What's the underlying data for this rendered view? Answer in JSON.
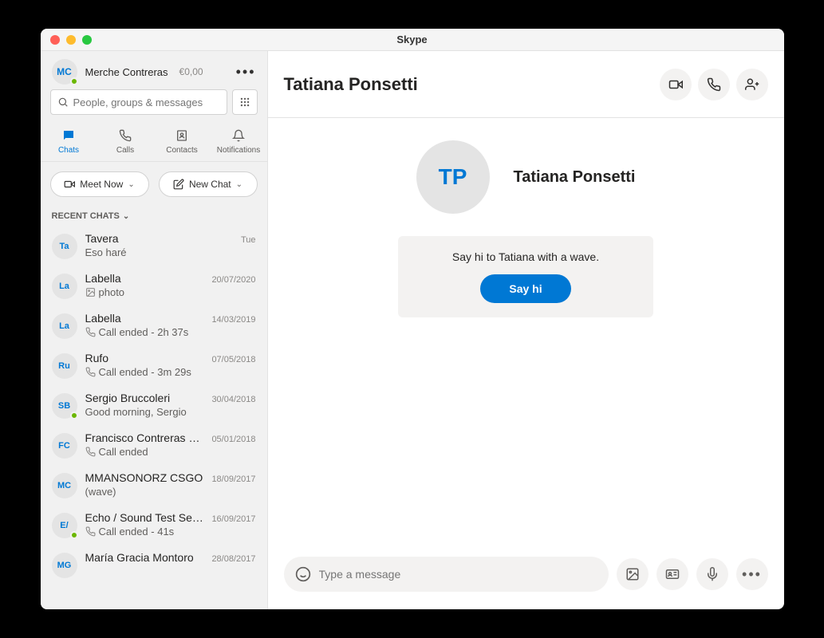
{
  "titlebar": {
    "title": "Skype"
  },
  "profile": {
    "initials": "MC",
    "name": "Merche Contreras",
    "balance": "€0,00"
  },
  "search": {
    "placeholder": "People, groups & messages"
  },
  "tabs": {
    "chats": "Chats",
    "calls": "Calls",
    "contacts": "Contacts",
    "notifications": "Notifications"
  },
  "actions": {
    "meet_now": "Meet Now",
    "new_chat": "New Chat"
  },
  "section": {
    "recent": "RECENT CHATS"
  },
  "chats": [
    {
      "initials": "Ta",
      "name": "Tavera",
      "date": "Tue",
      "preview": "Eso haré",
      "icon": "none",
      "presence": false
    },
    {
      "initials": "La",
      "name": "Labella",
      "date": "20/07/2020",
      "preview": "photo",
      "icon": "image",
      "presence": false
    },
    {
      "initials": "La",
      "name": "Labella",
      "date": "14/03/2019",
      "preview": "Call ended - 2h 37s",
      "icon": "call",
      "presence": false
    },
    {
      "initials": "Ru",
      "name": "Rufo",
      "date": "07/05/2018",
      "preview": "Call ended - 3m 29s",
      "icon": "call",
      "presence": false
    },
    {
      "initials": "SB",
      "name": "Sergio Bruccoleri",
      "date": "30/04/2018",
      "preview": "Good morning, Sergio",
      "icon": "none",
      "presence": true
    },
    {
      "initials": "FC",
      "name": "Francisco Contreras Segura",
      "date": "05/01/2018",
      "preview": "Call ended",
      "icon": "call",
      "presence": false
    },
    {
      "initials": "MC",
      "name": "MMANSONORZ CSGO",
      "date": "18/09/2017",
      "preview": "(wave)",
      "icon": "none",
      "presence": false
    },
    {
      "initials": "E/",
      "name": "Echo / Sound Test Service",
      "date": "16/09/2017",
      "preview": "Call ended - 41s",
      "icon": "call",
      "presence": true
    },
    {
      "initials": "MG",
      "name": "María Gracia Montoro",
      "date": "28/08/2017",
      "preview": "",
      "icon": "none",
      "presence": false
    }
  ],
  "conversation": {
    "title": "Tatiana Ponsetti",
    "initials": "TP",
    "name": "Tatiana Ponsetti",
    "wave_text": "Say hi to Tatiana with a wave.",
    "sayhi": "Say hi"
  },
  "composer": {
    "placeholder": "Type a message"
  }
}
